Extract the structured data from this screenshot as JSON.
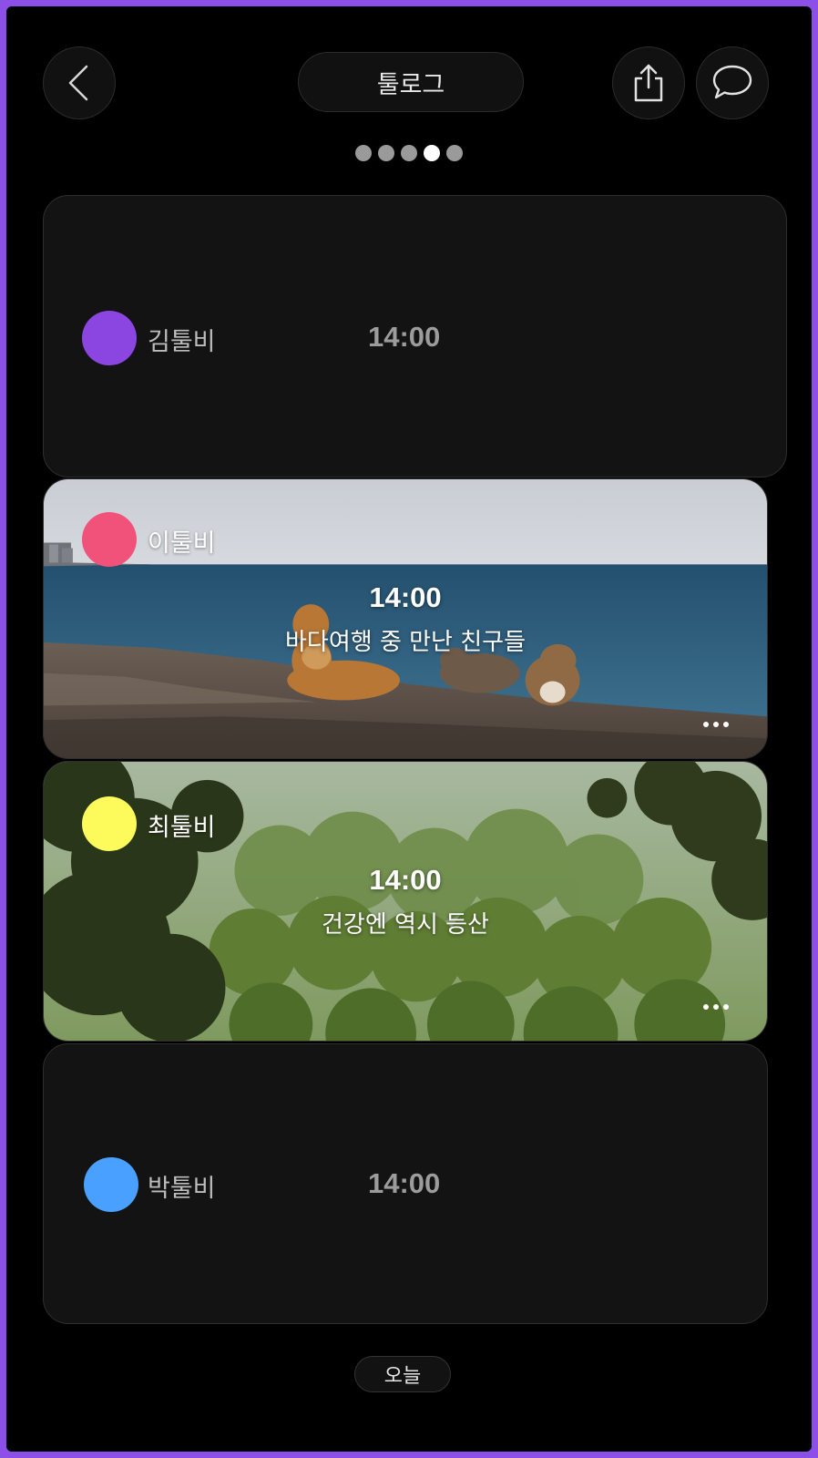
{
  "header": {
    "title": "툴로그",
    "back_icon": "chevron-left-icon",
    "share_icon": "share-icon",
    "chat_icon": "chat-bubble-icon"
  },
  "pager": {
    "total": 5,
    "active_index": 3
  },
  "cards": [
    {
      "name": "김툴비",
      "time": "14:00",
      "avatar_color": "#8b45e0",
      "caption": ""
    },
    {
      "name": "이툴비",
      "time": "14:00",
      "avatar_color": "#f0527a",
      "caption": "바다여행 중 만난 친구들"
    },
    {
      "name": "최툴비",
      "time": "14:00",
      "avatar_color": "#fdfb5c",
      "caption": "건강엔 역시 등산"
    },
    {
      "name": "박툴비",
      "time": "14:00",
      "avatar_color": "#4aa0ff",
      "caption": ""
    }
  ],
  "footer": {
    "today_label": "오늘"
  },
  "colors": {
    "frame": "#8c4fe8",
    "background": "#000000",
    "card": "#131313"
  }
}
